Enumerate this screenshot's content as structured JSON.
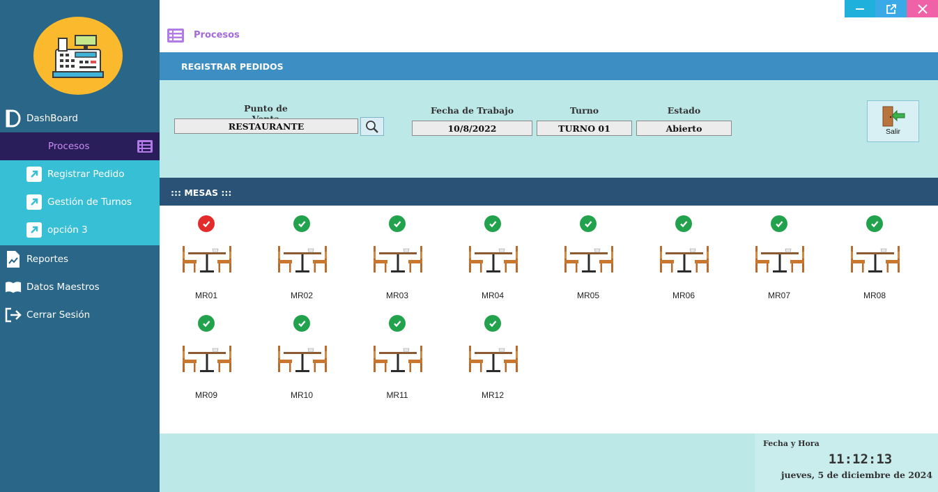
{
  "sidebar": {
    "items": [
      {
        "label": "DashBoard",
        "icon": "dashboard-icon"
      },
      {
        "label": "Procesos",
        "icon": "list-icon"
      },
      {
        "label": "Reportes",
        "icon": "report-icon"
      },
      {
        "label": "Datos Maestros",
        "icon": "book-icon"
      },
      {
        "label": "Cerrar Sesión",
        "icon": "logout-icon"
      }
    ],
    "submenu": [
      {
        "label": "Registrar Pedido",
        "icon": "arrow-link-icon"
      },
      {
        "label": "Gestión de Turnos",
        "icon": "arrow-link-icon"
      },
      {
        "label": "opción 3",
        "icon": "arrow-link-icon"
      }
    ],
    "logo_icon": "cash-register-icon"
  },
  "breadcrumb": {
    "label": "Procesos"
  },
  "header": {
    "title": "REGISTRAR PEDIDOS"
  },
  "form": {
    "punto_venta_label": "Punto de Venta",
    "punto_venta_value": "RESTAURANTE",
    "fecha_label": "Fecha de Trabajo",
    "fecha_value": "10/8/2022",
    "turno_label": "Turno",
    "turno_value": "TURNO 01",
    "estado_label": "Estado",
    "estado_value": "Abierto",
    "salir_label": "Salir"
  },
  "mesas": {
    "title": "::: MESAS :::",
    "items": [
      {
        "label": "MR01",
        "status": "occupied"
      },
      {
        "label": "MR02",
        "status": "free"
      },
      {
        "label": "MR03",
        "status": "free"
      },
      {
        "label": "MR04",
        "status": "free"
      },
      {
        "label": "MR05",
        "status": "free"
      },
      {
        "label": "MR06",
        "status": "free"
      },
      {
        "label": "MR07",
        "status": "free"
      },
      {
        "label": "MR08",
        "status": "free"
      },
      {
        "label": "MR09",
        "status": "free"
      },
      {
        "label": "MR10",
        "status": "free"
      },
      {
        "label": "MR11",
        "status": "free"
      },
      {
        "label": "MR12",
        "status": "free"
      }
    ]
  },
  "footer": {
    "datetime_label": "Fecha y Hora",
    "time": "11:12:13",
    "date": "jueves, 5 de diciembre de 2024"
  },
  "colors": {
    "sidebar_bg": "#2a6687",
    "submenu_bg": "#37bfd6",
    "active_bg": "#2a1e5a",
    "header_bg": "#3d8fc3",
    "mesas_band_bg": "#2a5277",
    "panel_bg": "#bde8e8",
    "status_free": "#23a24d",
    "status_occupied": "#e32b2b"
  }
}
